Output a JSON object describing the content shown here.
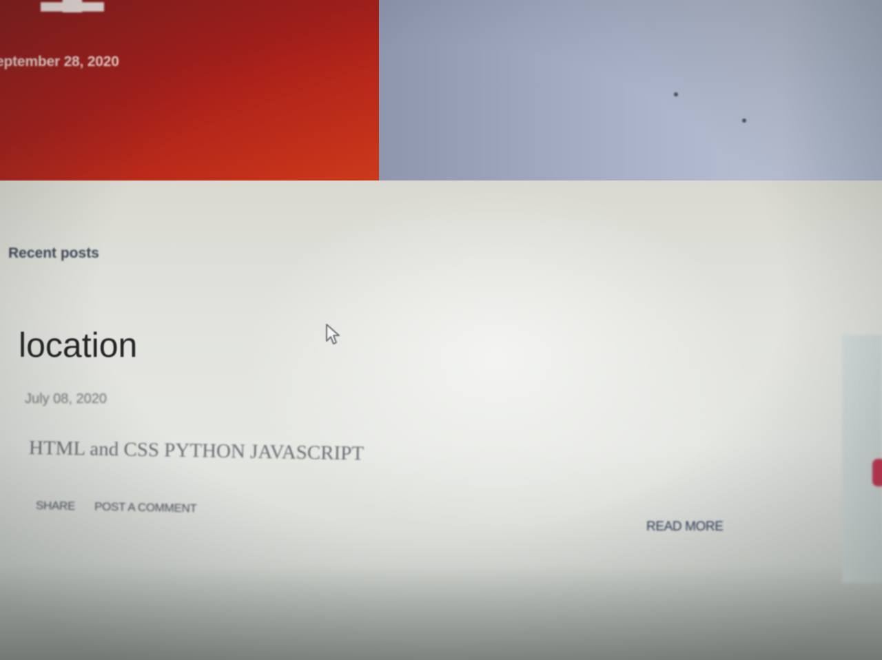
{
  "featured_post": {
    "date": "eptember 28, 2020"
  },
  "recent_posts": {
    "section_label": "Recent posts",
    "posts": [
      {
        "title": "location",
        "date": "July 08, 2020",
        "snippet": "HTML and CSS PYTHON JAVASCRIPT",
        "share_label": "SHARE",
        "comment_label": "POST A COMMENT",
        "read_more_label": "READ MORE"
      }
    ]
  },
  "colors": {
    "featured_card": "#a61e1a",
    "banner": "#a9b2c8",
    "page_background": "#e4e5e1",
    "accent_button": "#c6344f"
  },
  "icons": {
    "cursor": "mouse-pointer-icon"
  }
}
